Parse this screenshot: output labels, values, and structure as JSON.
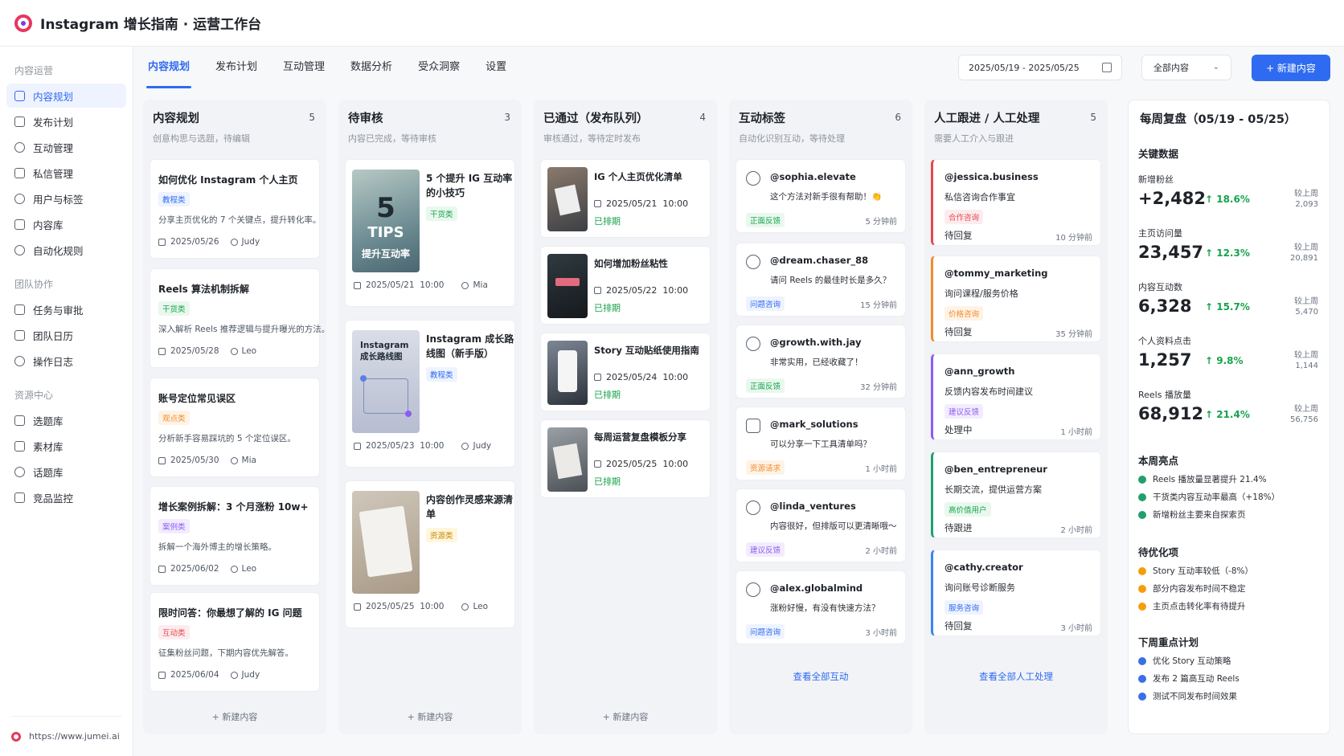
{
  "app": {
    "title": "Instagram 增长指南 · 运营工作台"
  },
  "sidebar": {
    "groups": [
      {
        "label": "内容运营",
        "items": [
          "内容规划",
          "发布计划",
          "互动管理",
          "私信管理",
          "用户与标签",
          "内容库",
          "自动化规则"
        ]
      },
      {
        "label": "团队协作",
        "items": [
          "任务与审批",
          "团队日历",
          "操作日志"
        ]
      },
      {
        "label": "资源中心",
        "items": [
          "选题库",
          "素材库",
          "话题库",
          "竞品监控"
        ]
      }
    ],
    "footer": "https://www.jumei.ai"
  },
  "tabs": [
    "内容规划",
    "发布计划",
    "互动管理",
    "数据分析",
    "受众洞察",
    "设置"
  ],
  "toolbar": {
    "date_range": "2025/05/19 - 2025/05/25",
    "filter": "全部内容",
    "new_button": "+ 新建内容"
  },
  "columns": {
    "planning": {
      "title": "内容规划",
      "count": "5",
      "subtitle": "创意构思与选题，待编辑",
      "add": "+ 新建内容",
      "cards": [
        {
          "title": "如何优化 Instagram 个人主页",
          "tag": "教程类",
          "desc": "分享主页优化的 7 个关键点，提升转化率。",
          "date": "2025/05/26",
          "owner": "Judy"
        },
        {
          "title": "Reels 算法机制拆解",
          "tag": "干货类",
          "desc": "深入解析 Reels 推荐逻辑与提升曝光的方法。",
          "date": "2025/05/28",
          "owner": "Leo"
        },
        {
          "title": "账号定位常见误区",
          "tag": "观点类",
          "desc": "分析新手容易踩坑的 5 个定位误区。",
          "date": "2025/05/30",
          "owner": "Mia"
        },
        {
          "title": "增长案例拆解：3 个月涨粉 10w+",
          "tag": "案例类",
          "desc": "拆解一个海外博主的增长策略。",
          "date": "2025/06/02",
          "owner": "Leo"
        },
        {
          "title": "限时问答：你最想了解的 IG 问题",
          "tag": "互动类",
          "desc": "征集粉丝问题，下期内容优先解答。",
          "date": "2025/06/04",
          "owner": "Judy"
        }
      ]
    },
    "pending": {
      "title": "待审核",
      "count": "3",
      "subtitle": "内容已完成，等待审核",
      "add": "+ 新建内容",
      "cards": [
        {
          "title": "5 个提升 IG 互动率的小技巧",
          "tag": "干货类",
          "date": "2025/05/21",
          "time": "10:00",
          "owner": "Mia",
          "thumb_big": "5",
          "thumb_mid": "TIPS",
          "thumb_small": "提升互动率"
        },
        {
          "title": "Instagram 成长路线图（新手版）",
          "tag": "教程类",
          "date": "2025/05/23",
          "time": "10:00",
          "owner": "Judy",
          "thumb_text": "Instagram 成长路线图"
        },
        {
          "title": "内容创作灵感来源清单",
          "tag": "资源类",
          "date": "2025/05/25",
          "time": "10:00",
          "owner": "Leo"
        }
      ]
    },
    "approved": {
      "title": "已通过（发布队列）",
      "count": "4",
      "subtitle": "审核通过，等待定时发布",
      "add": "+ 新建内容",
      "cards": [
        {
          "title": "IG 个人主页优化清单",
          "date": "2025/05/21",
          "time": "10:00",
          "status": "已排期"
        },
        {
          "title": "如何增加粉丝粘性",
          "date": "2025/05/22",
          "time": "10:00",
          "status": "已排期"
        },
        {
          "title": "Story 互动贴纸使用指南",
          "date": "2025/05/24",
          "time": "10:00",
          "status": "已排期"
        },
        {
          "title": "每周运营复盘模板分享",
          "date": "2025/05/25",
          "time": "10:00",
          "status": "已排期"
        }
      ]
    },
    "interactions": {
      "title": "互动标签",
      "count": "6",
      "subtitle": "自动化识别互动，等待处理",
      "link": "查看全部互动",
      "cards": [
        {
          "handle": "@sophia.elevate",
          "msg": "这个方法对新手很有帮助！👏",
          "tag": "正面反馈",
          "time": "5 分钟前"
        },
        {
          "handle": "@dream.chaser_88",
          "msg": "请问 Reels 的最佳时长是多久？",
          "tag": "问题咨询",
          "time": "15 分钟前"
        },
        {
          "handle": "@growth.with.jay",
          "msg": "非常实用，已经收藏了！",
          "tag": "正面反馈",
          "time": "32 分钟前"
        },
        {
          "handle": "@mark_solutions",
          "msg": "可以分享一下工具清单吗？",
          "tag": "资源请求",
          "time": "1 小时前"
        },
        {
          "handle": "@linda_ventures",
          "msg": "内容很好，但排版可以更清晰哦～",
          "tag": "建议反馈",
          "time": "2 小时前"
        },
        {
          "handle": "@alex.globalmind",
          "msg": "涨粉好慢，有没有快速方法？",
          "tag": "问题咨询",
          "time": "3 小时前"
        }
      ]
    },
    "followup": {
      "title": "人工跟进 / 人工处理",
      "count": "5",
      "subtitle": "需要人工介入与跟进",
      "link": "查看全部人工处理",
      "cards": [
        {
          "handle": "@jessica.business",
          "msg": "私信咨询合作事宜",
          "tag": "合作咨询",
          "status": "待回复",
          "time": "10 分钟前",
          "color": "#e5484d"
        },
        {
          "handle": "@tommy_marketing",
          "msg": "询问课程/服务价格",
          "tag": "价格咨询",
          "status": "待回复",
          "time": "35 分钟前",
          "color": "#f08c2e"
        },
        {
          "handle": "@ann_growth",
          "msg": "反馈内容发布时间建议",
          "tag": "建议反馈",
          "status": "处理中",
          "time": "1 小时前",
          "color": "#8b5cf6"
        },
        {
          "handle": "@ben_entrepreneur",
          "msg": "长期交流，提供运营方案",
          "tag": "高价值用户",
          "status": "待跟进",
          "time": "2 小时前",
          "color": "#22a06b"
        },
        {
          "handle": "@cathy.creator",
          "msg": "询问账号诊断服务",
          "tag": "服务咨询",
          "status": "待回复",
          "time": "3 小时前",
          "color": "#3b82f6"
        }
      ]
    }
  },
  "review": {
    "title": "每周复盘（05/19 - 05/25）",
    "key_label": "关键数据",
    "metrics": [
      {
        "label": "新增粉丝",
        "value": "+2,482",
        "change": "↑ 18.6%",
        "cmp_label": "较上周",
        "cmp_value": "2,093"
      },
      {
        "label": "主页访问量",
        "value": "23,457",
        "change": "↑ 12.3%",
        "cmp_label": "较上周",
        "cmp_value": "20,891"
      },
      {
        "label": "内容互动数",
        "value": "6,328",
        "change": "↑ 15.7%",
        "cmp_label": "较上周",
        "cmp_value": "5,470"
      },
      {
        "label": "个人资料点击",
        "value": "1,257",
        "change": "↑ 9.8%",
        "cmp_label": "较上周",
        "cmp_value": "1,144"
      },
      {
        "label": "Reels 播放量",
        "value": "68,912",
        "change": "↑ 21.4%",
        "cmp_label": "较上周",
        "cmp_value": "56,756"
      }
    ],
    "highlights_label": "本周亮点",
    "highlights": [
      "Reels 播放量显著提升 21.4%",
      "干货类内容互动率最高（+18%）",
      "新增粉丝主要来自探索页"
    ],
    "improve_label": "待优化项",
    "improve": [
      "Story 互动率较低（-8%）",
      "部分内容发布时间不稳定",
      "主页点击转化率有待提升"
    ],
    "next_label": "下周重点计划",
    "next": [
      "优化 Story 互动策略",
      "发布 2 篇高互动 Reels",
      "测试不同发布时间效果"
    ]
  },
  "colors": {
    "accent": "#2f6bf0",
    "up": "#16a34a",
    "brand": "#e8365d"
  }
}
